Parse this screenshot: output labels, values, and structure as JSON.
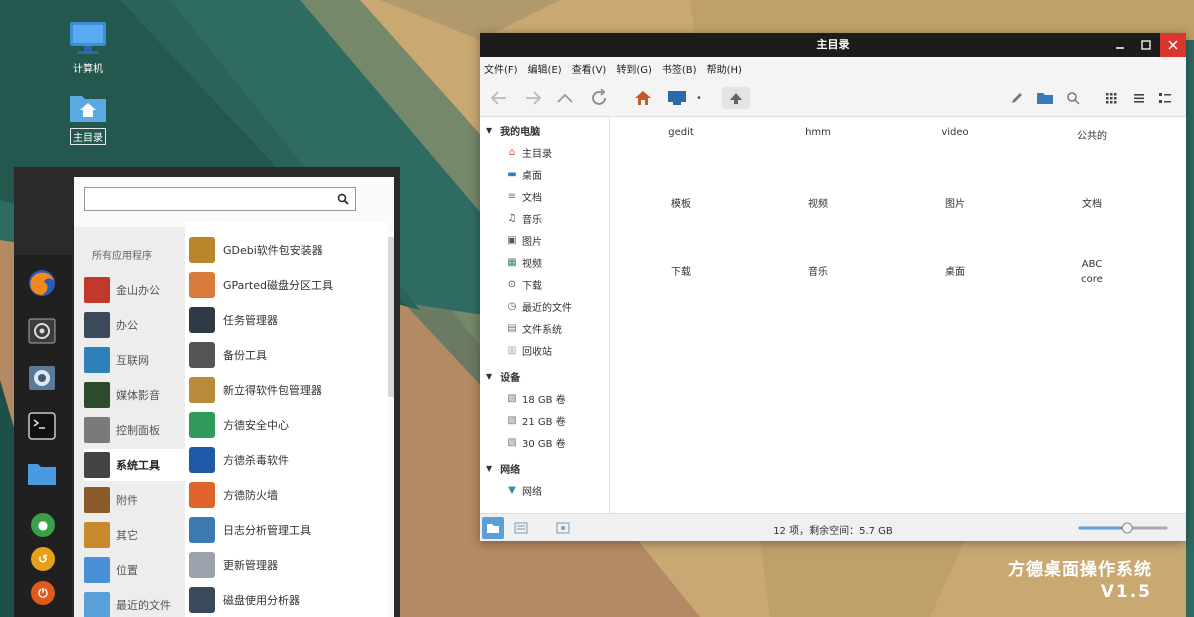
{
  "desktop": {
    "icons": [
      {
        "label": "计算机",
        "icon": "computer-icon"
      },
      {
        "label": "主目录",
        "icon": "home-folder-icon"
      }
    ]
  },
  "brand": {
    "name": "方德桌面操作系统",
    "version": "V1.5"
  },
  "dock": {
    "items": [
      "firefox-icon",
      "settings-icon",
      "screenshot-icon",
      "terminal-icon",
      "folder-icon",
      "lock-icon",
      "logout-icon",
      "power-icon"
    ]
  },
  "start_menu": {
    "search": {
      "value": "",
      "placeholder": ""
    },
    "categories_header": "所有应用程序",
    "categories": [
      {
        "label": "金山办公",
        "icon": "wps-icon",
        "color": "#c0392b"
      },
      {
        "label": "办公",
        "icon": "office-icon",
        "color": "#3b4a5a"
      },
      {
        "label": "互联网",
        "icon": "internet-icon",
        "color": "#2f7fb8"
      },
      {
        "label": "媒体影音",
        "icon": "media-icon",
        "color": "#2d4a2d"
      },
      {
        "label": "控制面板",
        "icon": "control-panel-icon",
        "color": "#7a7a7a"
      },
      {
        "label": "系统工具",
        "icon": "system-tools-icon",
        "color": "#444444",
        "selected": true
      },
      {
        "label": "附件",
        "icon": "accessories-icon",
        "color": "#8a5a2b"
      },
      {
        "label": "其它",
        "icon": "other-icon",
        "color": "#c98a2e"
      },
      {
        "label": "位置",
        "icon": "places-icon",
        "color": "#4a90d9"
      },
      {
        "label": "最近的文件",
        "icon": "recent-files-icon",
        "color": "#5aa0d8"
      }
    ],
    "apps": [
      {
        "label": "GDebi软件包安装器",
        "icon": "gdebi-icon",
        "color": "#b8862b"
      },
      {
        "label": "GParted磁盘分区工具",
        "icon": "gparted-icon",
        "color": "#d97a3a"
      },
      {
        "label": "任务管理器",
        "icon": "task-manager-icon",
        "color": "#2e3a46"
      },
      {
        "label": "备份工具",
        "icon": "backup-icon",
        "color": "#555555"
      },
      {
        "label": "新立得软件包管理器",
        "icon": "synaptic-icon",
        "color": "#b88a3a"
      },
      {
        "label": "方德安全中心",
        "icon": "security-center-icon",
        "color": "#2f9a5a"
      },
      {
        "label": "方德杀毒软件",
        "icon": "antivirus-icon",
        "color": "#1e5aa8"
      },
      {
        "label": "方德防火墙",
        "icon": "firewall-icon",
        "color": "#e0632a"
      },
      {
        "label": "日志分析管理工具",
        "icon": "log-analyzer-icon",
        "color": "#3a7ab0"
      },
      {
        "label": "更新管理器",
        "icon": "update-manager-icon",
        "color": "#9aa3ab"
      },
      {
        "label": "磁盘使用分析器",
        "icon": "disk-analyzer-icon",
        "color": "#3a4a5a"
      }
    ]
  },
  "file_manager": {
    "title": "主目录",
    "menu": [
      "文件(F)",
      "编辑(E)",
      "查看(V)",
      "转到(G)",
      "书签(B)",
      "帮助(H)"
    ],
    "toolbar": [
      "back-icon",
      "forward-icon",
      "up-icon",
      "reload-icon",
      "home-icon",
      "computer-icon",
      "up-arrow-icon",
      "edit-icon",
      "new-folder-icon",
      "search-icon",
      "icon-view-icon",
      "list-view-icon",
      "compact-view-icon"
    ],
    "sidebar": {
      "sections": [
        {
          "title": "我的电脑",
          "items": [
            {
              "label": "主目录",
              "icon": "home-icon"
            },
            {
              "label": "桌面",
              "icon": "desktop-icon"
            },
            {
              "label": "文档",
              "icon": "documents-icon"
            },
            {
              "label": "音乐",
              "icon": "music-icon"
            },
            {
              "label": "图片",
              "icon": "pictures-icon"
            },
            {
              "label": "视频",
              "icon": "videos-icon"
            },
            {
              "label": "下载",
              "icon": "downloads-icon"
            },
            {
              "label": "最近的文件",
              "icon": "recent-icon"
            },
            {
              "label": "文件系统",
              "icon": "filesystem-icon"
            },
            {
              "label": "回收站",
              "icon": "trash-icon"
            }
          ]
        },
        {
          "title": "设备",
          "items": [
            {
              "label": "18 GB 卷",
              "icon": "drive-icon"
            },
            {
              "label": "21 GB 卷",
              "icon": "drive-icon"
            },
            {
              "label": "30 GB 卷",
              "icon": "drive-icon"
            }
          ]
        },
        {
          "title": "网络",
          "items": [
            {
              "label": "网络",
              "icon": "network-icon"
            }
          ]
        }
      ]
    },
    "files": [
      {
        "name": "gedit",
        "icon": "folder-icon"
      },
      {
        "name": "hmm",
        "icon": "folder-icon"
      },
      {
        "name": "video",
        "icon": "folder-icon"
      },
      {
        "name": "公共的",
        "icon": "public-folder-icon"
      },
      {
        "name": "模板",
        "icon": "templates-folder-icon"
      },
      {
        "name": "视频",
        "icon": "videos-folder-icon"
      },
      {
        "name": "图片",
        "icon": "pictures-folder-icon"
      },
      {
        "name": "文档",
        "icon": "documents-folder-icon"
      },
      {
        "name": "下载",
        "icon": "downloads-folder-icon"
      },
      {
        "name": "音乐",
        "icon": "music-folder-icon"
      },
      {
        "name": "桌面",
        "icon": "desktop-folder-icon"
      },
      {
        "name": "core",
        "icon": "text-file-icon"
      }
    ],
    "status": "12 项，剩余空间：5.7 GB",
    "zoom": 0.55
  },
  "colors": {
    "accent": "#5a9fd8",
    "close": "#d9362f",
    "titlebar": "#1c1c1c"
  }
}
